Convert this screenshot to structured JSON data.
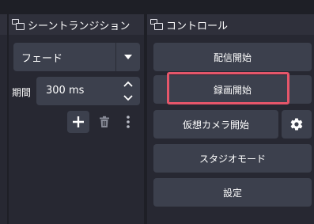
{
  "transitions": {
    "title": "シーントランジション",
    "selected": "フェード",
    "duration_label": "期間",
    "duration_value": "300 ms"
  },
  "controls": {
    "title": "コントロール",
    "start_streaming": "配信開始",
    "start_recording": "録画開始",
    "start_virtual_camera": "仮想カメラ開始",
    "studio_mode": "スタジオモード",
    "settings": "設定"
  },
  "colors": {
    "highlight": "#e5566a",
    "button": "#3c404d",
    "panel": "#272832",
    "header": "#2f303b"
  }
}
